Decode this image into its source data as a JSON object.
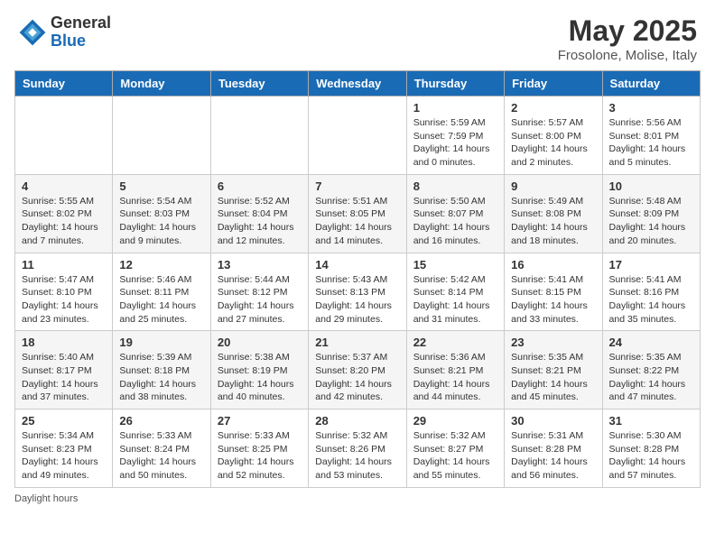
{
  "header": {
    "logo_general": "General",
    "logo_blue": "Blue",
    "month_title": "May 2025",
    "subtitle": "Frosolone, Molise, Italy"
  },
  "footer": {
    "daylight_label": "Daylight hours"
  },
  "calendar": {
    "days_of_week": [
      "Sunday",
      "Monday",
      "Tuesday",
      "Wednesday",
      "Thursday",
      "Friday",
      "Saturday"
    ],
    "weeks": [
      [
        {
          "day": "",
          "info": ""
        },
        {
          "day": "",
          "info": ""
        },
        {
          "day": "",
          "info": ""
        },
        {
          "day": "",
          "info": ""
        },
        {
          "day": "1",
          "info": "Sunrise: 5:59 AM\nSunset: 7:59 PM\nDaylight: 14 hours\nand 0 minutes."
        },
        {
          "day": "2",
          "info": "Sunrise: 5:57 AM\nSunset: 8:00 PM\nDaylight: 14 hours\nand 2 minutes."
        },
        {
          "day": "3",
          "info": "Sunrise: 5:56 AM\nSunset: 8:01 PM\nDaylight: 14 hours\nand 5 minutes."
        }
      ],
      [
        {
          "day": "4",
          "info": "Sunrise: 5:55 AM\nSunset: 8:02 PM\nDaylight: 14 hours\nand 7 minutes."
        },
        {
          "day": "5",
          "info": "Sunrise: 5:54 AM\nSunset: 8:03 PM\nDaylight: 14 hours\nand 9 minutes."
        },
        {
          "day": "6",
          "info": "Sunrise: 5:52 AM\nSunset: 8:04 PM\nDaylight: 14 hours\nand 12 minutes."
        },
        {
          "day": "7",
          "info": "Sunrise: 5:51 AM\nSunset: 8:05 PM\nDaylight: 14 hours\nand 14 minutes."
        },
        {
          "day": "8",
          "info": "Sunrise: 5:50 AM\nSunset: 8:07 PM\nDaylight: 14 hours\nand 16 minutes."
        },
        {
          "day": "9",
          "info": "Sunrise: 5:49 AM\nSunset: 8:08 PM\nDaylight: 14 hours\nand 18 minutes."
        },
        {
          "day": "10",
          "info": "Sunrise: 5:48 AM\nSunset: 8:09 PM\nDaylight: 14 hours\nand 20 minutes."
        }
      ],
      [
        {
          "day": "11",
          "info": "Sunrise: 5:47 AM\nSunset: 8:10 PM\nDaylight: 14 hours\nand 23 minutes."
        },
        {
          "day": "12",
          "info": "Sunrise: 5:46 AM\nSunset: 8:11 PM\nDaylight: 14 hours\nand 25 minutes."
        },
        {
          "day": "13",
          "info": "Sunrise: 5:44 AM\nSunset: 8:12 PM\nDaylight: 14 hours\nand 27 minutes."
        },
        {
          "day": "14",
          "info": "Sunrise: 5:43 AM\nSunset: 8:13 PM\nDaylight: 14 hours\nand 29 minutes."
        },
        {
          "day": "15",
          "info": "Sunrise: 5:42 AM\nSunset: 8:14 PM\nDaylight: 14 hours\nand 31 minutes."
        },
        {
          "day": "16",
          "info": "Sunrise: 5:41 AM\nSunset: 8:15 PM\nDaylight: 14 hours\nand 33 minutes."
        },
        {
          "day": "17",
          "info": "Sunrise: 5:41 AM\nSunset: 8:16 PM\nDaylight: 14 hours\nand 35 minutes."
        }
      ],
      [
        {
          "day": "18",
          "info": "Sunrise: 5:40 AM\nSunset: 8:17 PM\nDaylight: 14 hours\nand 37 minutes."
        },
        {
          "day": "19",
          "info": "Sunrise: 5:39 AM\nSunset: 8:18 PM\nDaylight: 14 hours\nand 38 minutes."
        },
        {
          "day": "20",
          "info": "Sunrise: 5:38 AM\nSunset: 8:19 PM\nDaylight: 14 hours\nand 40 minutes."
        },
        {
          "day": "21",
          "info": "Sunrise: 5:37 AM\nSunset: 8:20 PM\nDaylight: 14 hours\nand 42 minutes."
        },
        {
          "day": "22",
          "info": "Sunrise: 5:36 AM\nSunset: 8:21 PM\nDaylight: 14 hours\nand 44 minutes."
        },
        {
          "day": "23",
          "info": "Sunrise: 5:35 AM\nSunset: 8:21 PM\nDaylight: 14 hours\nand 45 minutes."
        },
        {
          "day": "24",
          "info": "Sunrise: 5:35 AM\nSunset: 8:22 PM\nDaylight: 14 hours\nand 47 minutes."
        }
      ],
      [
        {
          "day": "25",
          "info": "Sunrise: 5:34 AM\nSunset: 8:23 PM\nDaylight: 14 hours\nand 49 minutes."
        },
        {
          "day": "26",
          "info": "Sunrise: 5:33 AM\nSunset: 8:24 PM\nDaylight: 14 hours\nand 50 minutes."
        },
        {
          "day": "27",
          "info": "Sunrise: 5:33 AM\nSunset: 8:25 PM\nDaylight: 14 hours\nand 52 minutes."
        },
        {
          "day": "28",
          "info": "Sunrise: 5:32 AM\nSunset: 8:26 PM\nDaylight: 14 hours\nand 53 minutes."
        },
        {
          "day": "29",
          "info": "Sunrise: 5:32 AM\nSunset: 8:27 PM\nDaylight: 14 hours\nand 55 minutes."
        },
        {
          "day": "30",
          "info": "Sunrise: 5:31 AM\nSunset: 8:28 PM\nDaylight: 14 hours\nand 56 minutes."
        },
        {
          "day": "31",
          "info": "Sunrise: 5:30 AM\nSunset: 8:28 PM\nDaylight: 14 hours\nand 57 minutes."
        }
      ]
    ]
  }
}
